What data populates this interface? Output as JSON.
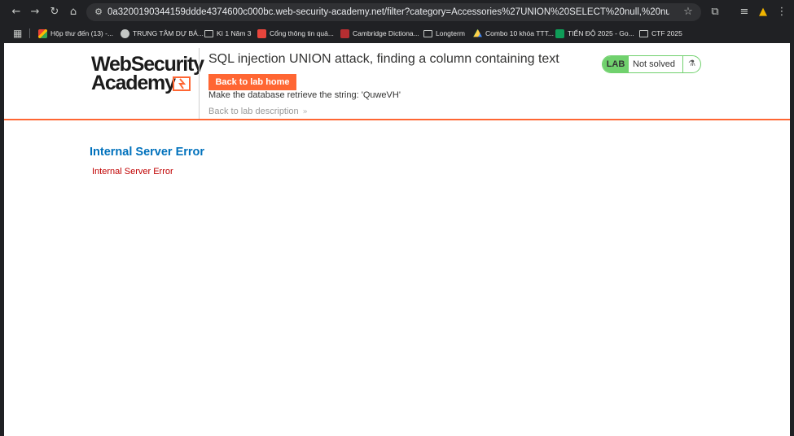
{
  "browser": {
    "url": "0a3200190344159ddde4374600c000bc.web-security-academy.net/filter?category=Accessories%27UNION%20SELECT%20null,%20null%20--"
  },
  "bookmarks": [
    {
      "label": "Hộp thư đến (13) -...",
      "icon": "gmail-icon"
    },
    {
      "label": "TRUNG TÂM DỰ BÁ...",
      "icon": "globe-icon"
    },
    {
      "label": "Kì 1 Năm 3",
      "icon": "folder-icon"
    },
    {
      "label": "Cổng thông tin quả...",
      "icon": "portal-icon"
    },
    {
      "label": "Cambridge Dictiona...",
      "icon": "cambridge-icon"
    },
    {
      "label": "Longterm",
      "icon": "folder-icon"
    },
    {
      "label": "Combo 10 khóa TTT...",
      "icon": "drive-icon"
    },
    {
      "label": "TIẾN ĐỘ 2025 - Go...",
      "icon": "sheets-icon"
    },
    {
      "label": "CTF 2025",
      "icon": "folder-icon"
    }
  ],
  "lab": {
    "logo_line1": "WebSecurity",
    "logo_line2": "Academy",
    "title": "SQL injection UNION attack, finding a column containing text",
    "home_button": "Back to lab home",
    "description": "Make the database retrieve the string: 'QuweVH'",
    "back_link": "Back to lab description",
    "status_tag": "LAB",
    "status": "Not solved"
  },
  "error": {
    "title": "Internal Server Error",
    "message": "Internal Server Error"
  },
  "colors": {
    "accent": "#ff6633",
    "solved_green": "#70d16d",
    "error_title": "#0071bc",
    "error_message": "#c00000"
  }
}
